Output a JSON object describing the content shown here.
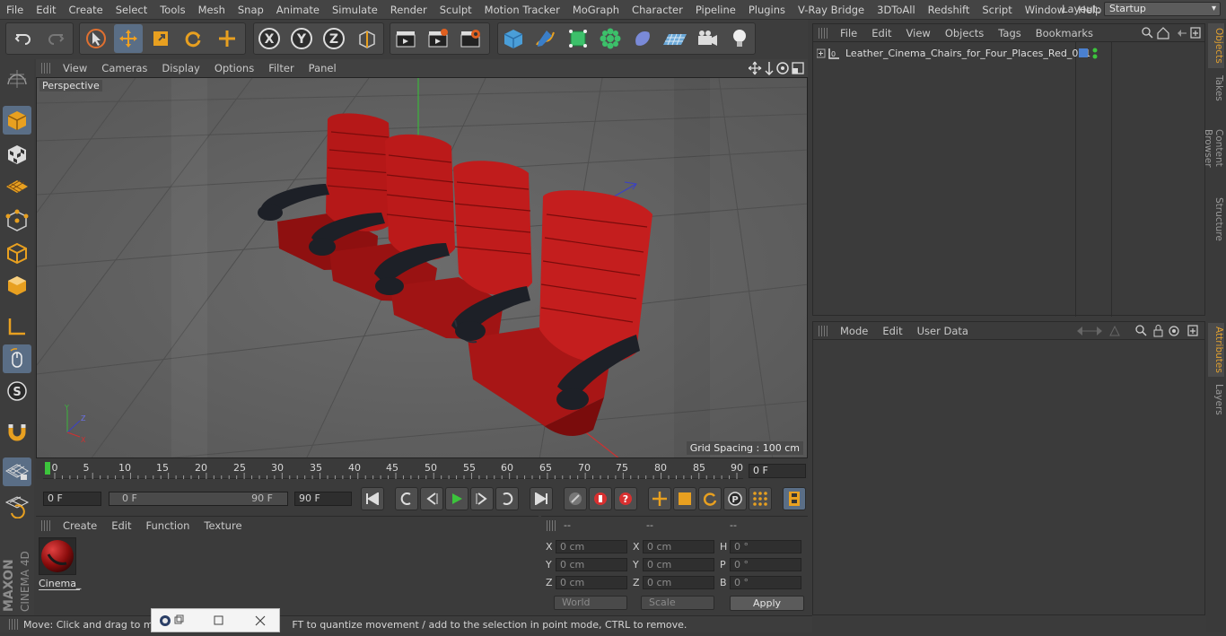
{
  "menubar": {
    "items": [
      "File",
      "Edit",
      "Create",
      "Select",
      "Tools",
      "Mesh",
      "Snap",
      "Animate",
      "Simulate",
      "Render",
      "Sculpt",
      "Motion Tracker",
      "MoGraph",
      "Character",
      "Pipeline",
      "Plugins",
      "V-Ray Bridge",
      "3DToAll",
      "Redshift",
      "Script",
      "Window",
      "Help"
    ],
    "layout_label": "Layout:",
    "layout_value": "Startup"
  },
  "viewport": {
    "menu": [
      "View",
      "Cameras",
      "Display",
      "Options",
      "Filter",
      "Panel"
    ],
    "label": "Perspective",
    "grid_spacing": "Grid Spacing : 100 cm"
  },
  "timeline": {
    "ticks": [
      "0",
      "5",
      "10",
      "15",
      "20",
      "25",
      "30",
      "35",
      "40",
      "45",
      "50",
      "55",
      "60",
      "65",
      "70",
      "75",
      "80",
      "85",
      "90"
    ],
    "current_frame": "0 F"
  },
  "transport": {
    "start_field": "0 F",
    "range_start": "0 F",
    "range_end": "90 F",
    "end_field": "90 F"
  },
  "materials": {
    "menu": [
      "Create",
      "Edit",
      "Function",
      "Texture"
    ],
    "items": [
      {
        "name": "Cinema_"
      }
    ]
  },
  "coordinates": {
    "headers": [
      "--",
      "--",
      "--"
    ],
    "rows": [
      {
        "l1": "X",
        "v1": "0 cm",
        "l2": "X",
        "v2": "0 cm",
        "l3": "H",
        "v3": "0 °"
      },
      {
        "l1": "Y",
        "v1": "0 cm",
        "l2": "Y",
        "v2": "0 cm",
        "l3": "P",
        "v3": "0 °"
      },
      {
        "l1": "Z",
        "v1": "0 cm",
        "l2": "Z",
        "v2": "0 cm",
        "l3": "B",
        "v3": "0 °"
      }
    ],
    "mode_world": "World",
    "mode_scale": "Scale",
    "apply": "Apply"
  },
  "status": {
    "text_left": "Move: Click and drag to mo",
    "text_right": "FT to quantize movement / add to the selection in point mode, CTRL to remove."
  },
  "objects": {
    "menu": [
      "File",
      "Edit",
      "View",
      "Objects",
      "Tags",
      "Bookmarks"
    ],
    "items": [
      {
        "name": "Leather_Cinema_Chairs_for_Four_Places_Red_001"
      }
    ]
  },
  "attributes": {
    "menu": [
      "Mode",
      "Edit",
      "User Data"
    ]
  },
  "sidetabs": [
    "Objects",
    "Takes",
    "Content Browser",
    "Structure",
    "Attributes",
    "Layers"
  ],
  "brand": {
    "line1": "MAXON",
    "line2": "CINEMA 4D"
  },
  "colors": {
    "accent": "#5a6e86",
    "chair_red": "#b01515",
    "armrest": "#1c1f26",
    "tab_active": "#e0a030"
  }
}
